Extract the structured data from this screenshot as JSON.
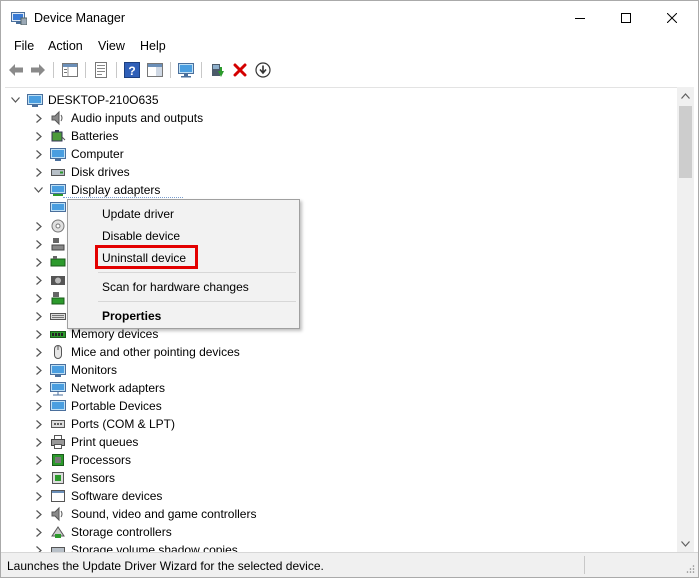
{
  "window": {
    "title": "Device Manager"
  },
  "menu": [
    "File",
    "Action",
    "View",
    "Help"
  ],
  "tree": {
    "root": "DESKTOP-210O635",
    "items": [
      {
        "label": "Audio inputs and outputs",
        "icon": "speaker-icon",
        "expanded": false
      },
      {
        "label": "Batteries",
        "icon": "battery-icon",
        "expanded": false
      },
      {
        "label": "Computer",
        "icon": "monitor-icon",
        "expanded": false
      },
      {
        "label": "Disk drives",
        "icon": "disk-icon",
        "expanded": false
      },
      {
        "label": "Display adapters",
        "icon": "display-adapter-icon",
        "expanded": true
      },
      {
        "label": "",
        "icon": "display-adapter-icon",
        "child": true
      },
      {
        "label": "",
        "icon": "dvd-icon"
      },
      {
        "label": "",
        "icon": "hid-icon"
      },
      {
        "label": "",
        "icon": "ide-icon"
      },
      {
        "label": "",
        "icon": "imaging-icon"
      },
      {
        "label": "",
        "icon": "keyboard-icon"
      },
      {
        "label": "",
        "icon": "keyboard-icon"
      },
      {
        "label": "Memory devices",
        "icon": "memory-icon",
        "expanded": false
      },
      {
        "label": "Mice and other pointing devices",
        "icon": "mouse-icon",
        "expanded": false
      },
      {
        "label": "Monitors",
        "icon": "monitor-icon",
        "expanded": false
      },
      {
        "label": "Network adapters",
        "icon": "network-icon",
        "expanded": false
      },
      {
        "label": "Portable Devices",
        "icon": "portable-icon",
        "expanded": false
      },
      {
        "label": "Ports (COM & LPT)",
        "icon": "port-icon",
        "expanded": false
      },
      {
        "label": "Print queues",
        "icon": "printer-icon",
        "expanded": false
      },
      {
        "label": "Processors",
        "icon": "cpu-icon",
        "expanded": false
      },
      {
        "label": "Sensors",
        "icon": "sensor-icon",
        "expanded": false
      },
      {
        "label": "Software devices",
        "icon": "software-icon",
        "expanded": false
      },
      {
        "label": "Sound, video and game controllers",
        "icon": "speaker-icon",
        "expanded": false
      },
      {
        "label": "Storage controllers",
        "icon": "storage-icon",
        "expanded": false
      },
      {
        "label": "Storage volume shadow copies",
        "icon": "disk-icon",
        "expanded": false
      }
    ]
  },
  "context_menu": {
    "update": "Update driver",
    "disable": "Disable device",
    "uninstall": "Uninstall device",
    "scan": "Scan for hardware changes",
    "properties": "Properties"
  },
  "status": "Launches the Update Driver Wizard for the selected device.",
  "colors": {
    "highlight": "#e30000",
    "accent_blue": "#1e6fd9",
    "delete_red": "#d40000",
    "green": "#2c9a2c"
  }
}
